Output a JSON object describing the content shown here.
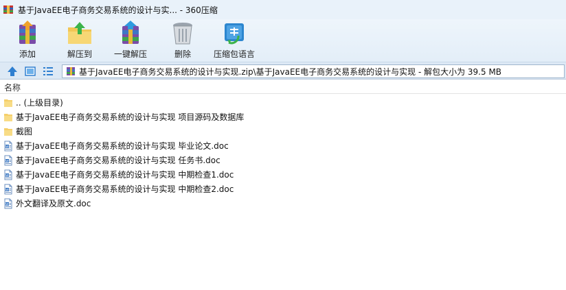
{
  "window": {
    "title": "基于JavaEE电子商务交易系统的设计与实... - 360压缩"
  },
  "toolbar": {
    "add_label": "添加",
    "extract_to_label": "解压到",
    "one_click_extract_label": "一键解压",
    "delete_label": "删除",
    "language_label": "压缩包语言"
  },
  "icons": {
    "add": "rar-add-icon",
    "extract_to": "folder-extract-icon",
    "one_click_extract": "rar-extract-icon",
    "delete": "trash-can-icon",
    "language": "language-code-icon",
    "up": "up-arrow-icon",
    "view_thumb": "thumbnail-view-icon",
    "view_list": "list-view-icon"
  },
  "address": {
    "path": "基于JavaEE电子商务交易系统的设计与实现.zip\\基于JavaEE电子商务交易系统的设计与实现 - 解包大小为 39.5 MB"
  },
  "list": {
    "name_header": "名称",
    "items": [
      {
        "name": ".. (上级目录)",
        "kind": "folder"
      },
      {
        "name": "基于JavaEE电子商务交易系统的设计与实现 项目源码及数据库",
        "kind": "folder"
      },
      {
        "name": "截图",
        "kind": "folder"
      },
      {
        "name": "基于JavaEE电子商务交易系统的设计与实现 毕业论文.doc",
        "kind": "doc"
      },
      {
        "name": "基于JavaEE电子商务交易系统的设计与实现 任务书.doc",
        "kind": "doc"
      },
      {
        "name": "基于JavaEE电子商务交易系统的设计与实现 中期检查1.doc",
        "kind": "doc"
      },
      {
        "name": "基于JavaEE电子商务交易系统的设计与实现 中期检查2.doc",
        "kind": "doc"
      },
      {
        "name": "外文翻译及原文.doc",
        "kind": "doc"
      }
    ]
  },
  "colors": {
    "folder": "#f5cf6a",
    "accent": "#2f7fd0",
    "titlebar": "#e9f2fa"
  }
}
